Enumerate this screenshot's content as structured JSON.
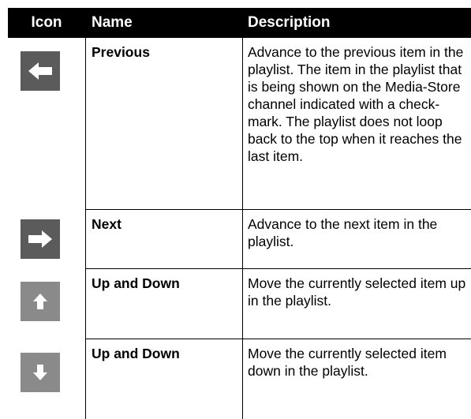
{
  "header": {
    "icon": "Icon",
    "name": "Name",
    "description": "Description"
  },
  "rows": [
    {
      "icon": "arrow-left-icon",
      "name": "Previous",
      "description": "Advance to the previous item in the playlist. The item in the playlist that is being shown on the Media-Store channel indicated with a check-mark. The playlist does not loop back to the top when it reaches the last item."
    },
    {
      "icon": "arrow-right-icon",
      "name": "Next",
      "description": "Advance to the next item in the playlist."
    },
    {
      "icon": "arrow-up-icon",
      "name": "Up and Down",
      "description": "Move the currently selected item up in the playlist."
    },
    {
      "icon": "arrow-down-icon",
      "name": "Up and Down",
      "description": "Move the currently selected item down in the playlist."
    }
  ],
  "colors": {
    "header_bg": "#000000",
    "header_text": "#ffffff",
    "tile_dark": "#5b5b5b",
    "tile_light": "#8a8a8a"
  }
}
